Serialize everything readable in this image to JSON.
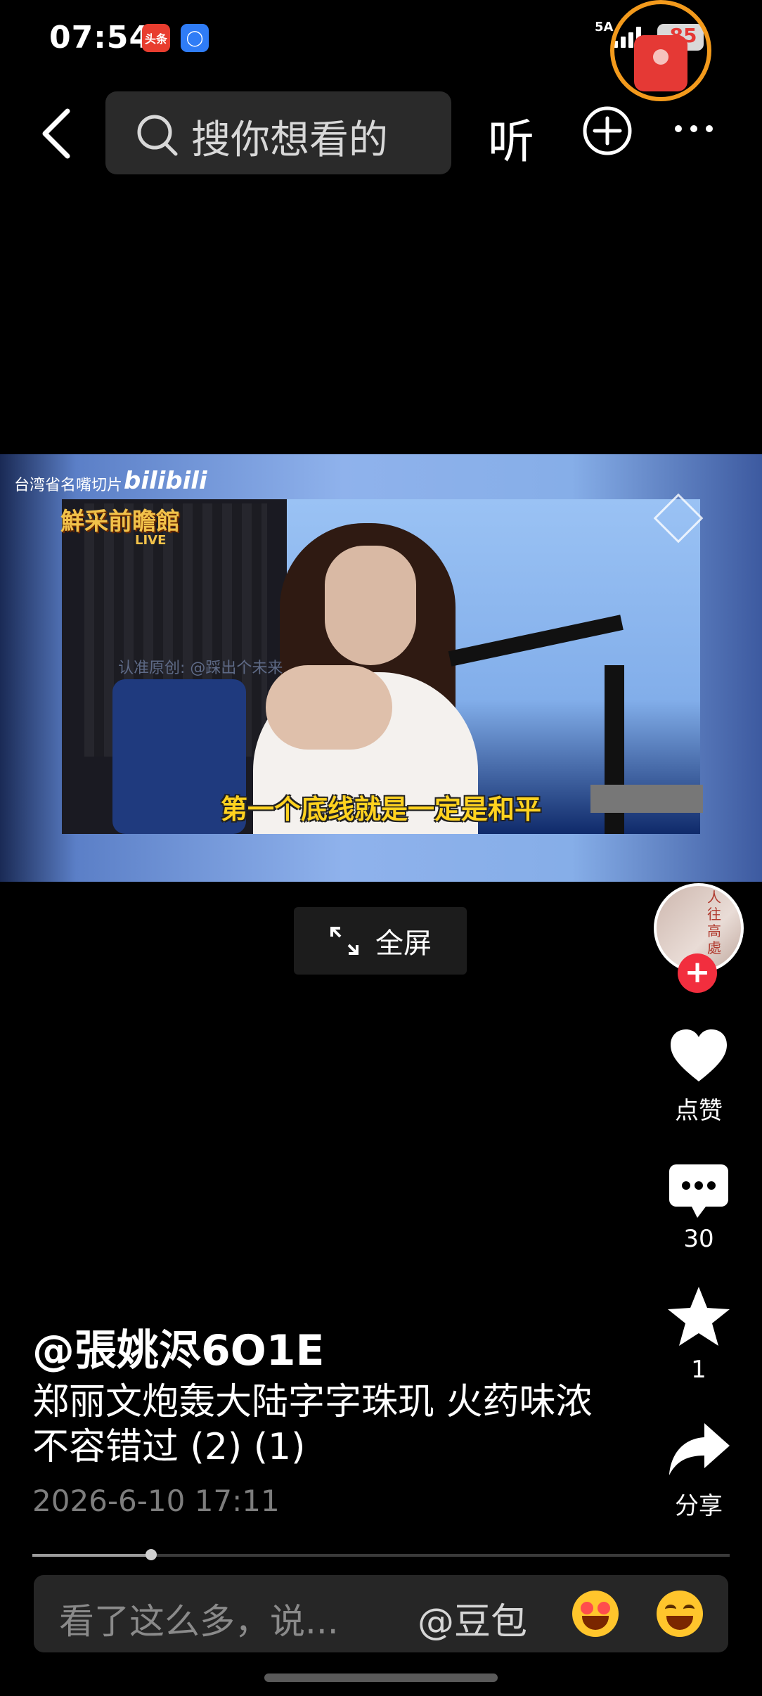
{
  "status_bar": {
    "time": "07:54",
    "app_badges": [
      "头条",
      ""
    ],
    "network": "5A",
    "battery": "85"
  },
  "nav": {
    "search_placeholder": "搜你想看的",
    "listen_label": "听"
  },
  "video": {
    "watermark_text": "台湾省名嘴切片",
    "watermark_brand": "bilibili",
    "show_logo": "鮮采前瞻館",
    "show_tag": "LIVE",
    "credit_text": "认准原创: @踩出个未来",
    "subtitle": "第一个底线就是一定是和平"
  },
  "fullscreen_label": "全屏",
  "rail": {
    "avatar_text": "人往高處",
    "follow_symbol": "+",
    "like_label": "点赞",
    "comment_count": "30",
    "favorite_count": "1",
    "share_label": "分享"
  },
  "post": {
    "author": "@張姚浕6O1E",
    "title": "郑丽文炮轰大陆字字珠玑 火药味浓不容错过 (2) (1)",
    "date": "2026-6-10 17:11",
    "progress_fraction": 0.17
  },
  "comment_bar": {
    "placeholder": "看了这么多，说...",
    "mention": "@豆包"
  },
  "colors": {
    "background": "#000000",
    "follow_red": "#f22e3e",
    "subtitle_yellow": "#ffd21f",
    "ring_orange": "#f39a1c"
  }
}
